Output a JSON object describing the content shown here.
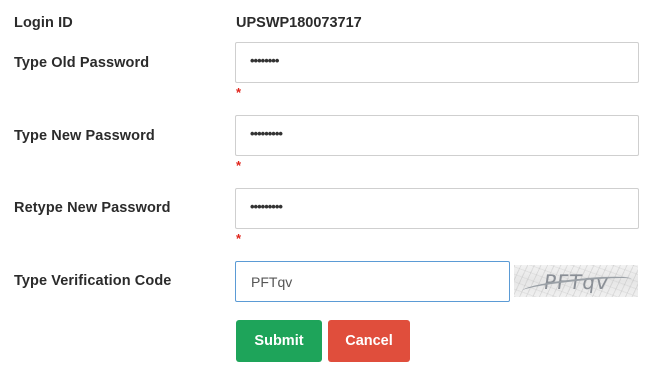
{
  "form": {
    "login_id": {
      "label": "Login ID",
      "value": "UPSWP180073717"
    },
    "old_password": {
      "label": "Type Old Password",
      "value": "••••••••",
      "required_mark": "*"
    },
    "new_password": {
      "label": "Type New Password",
      "value": "•••••••••",
      "required_mark": "*"
    },
    "retype_password": {
      "label": "Retype New Password",
      "value": "•••••••••",
      "required_mark": "*"
    },
    "verification": {
      "label": "Type Verification Code",
      "value": "PFTqv",
      "captcha_text": "PFTqv"
    }
  },
  "buttons": {
    "submit": "Submit",
    "cancel": "Cancel"
  },
  "colors": {
    "submit": "#1ea45a",
    "cancel": "#e04e3c",
    "required": "#e0241b",
    "focus_border": "#5b9bd5"
  }
}
